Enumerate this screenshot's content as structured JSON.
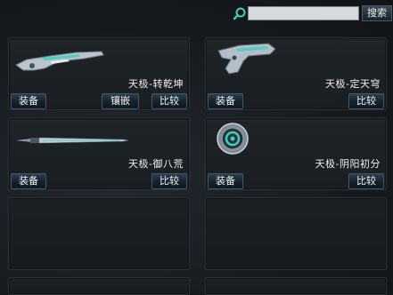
{
  "search": {
    "placeholder": "",
    "button_label": "搜索"
  },
  "cards": [
    {
      "name": "天极-转乾坤",
      "equip_label": "装备",
      "inlay_label": "镶嵌",
      "compare_label": "比较",
      "icon": "rifle-icon"
    },
    {
      "name": "天极-定天穹",
      "equip_label": "装备",
      "compare_label": "比较",
      "icon": "pistol-icon"
    },
    {
      "name": "天极-御八荒",
      "equip_label": "装备",
      "compare_label": "比较",
      "icon": "sword-icon"
    },
    {
      "name": "天极-阴阳初分",
      "equip_label": "装备",
      "compare_label": "比较",
      "icon": "grenade-icon"
    }
  ],
  "colors": {
    "accent": "#3fd0c0",
    "button_border": "#3f5766"
  }
}
